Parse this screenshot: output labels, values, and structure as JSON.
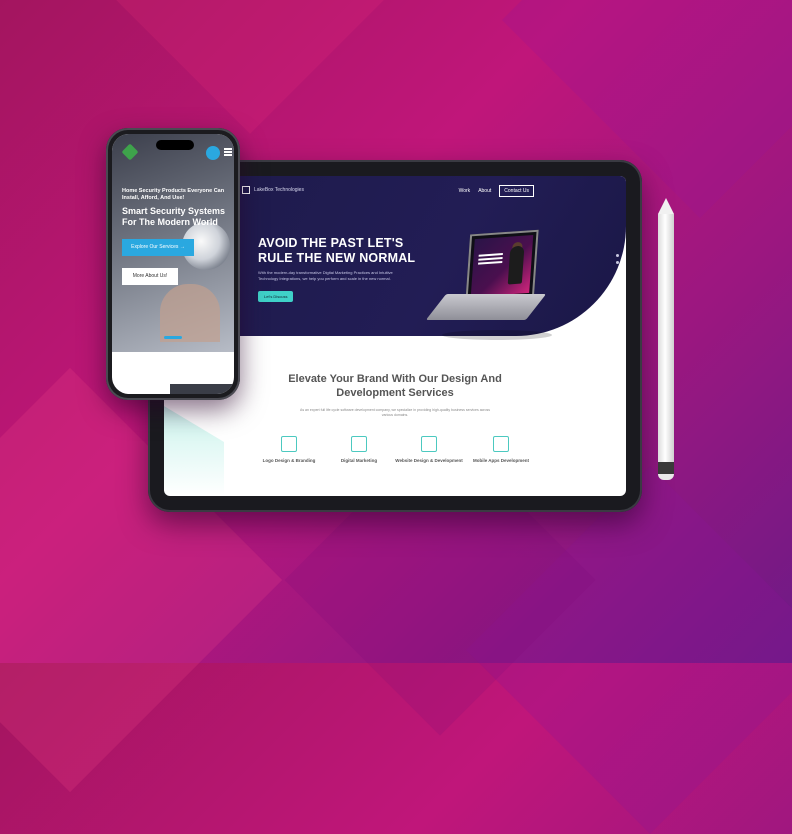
{
  "tablet_site": {
    "brand": "LakeBox Technologies",
    "nav": {
      "work": "Work",
      "about": "About",
      "contact": "Contact Us"
    },
    "hero": {
      "title": "AVOID THE PAST LET'S RULE THE NEW NORMAL",
      "text": "With the modern-day transformative Digital Marketing Practices and Intuitive Technology Integrations, we help you perform and scale in the new normal.",
      "button": "Let's Discuss"
    },
    "services": {
      "title": "Elevate Your Brand With Our Design And Development Services",
      "text": "As an expert full life cycle software development company, we specialize in providing high-quality business services across various domains.",
      "items": [
        {
          "label": "Logo Design & Branding",
          "icon": "logo-design-icon"
        },
        {
          "label": "Digital Marketing",
          "icon": "digital-marketing-icon"
        },
        {
          "label": "Website Design & Development",
          "icon": "website-design-icon"
        },
        {
          "label": "Mobile Apps Development",
          "icon": "mobile-apps-icon"
        }
      ]
    }
  },
  "phone_site": {
    "subtitle": "Home Security Products Everyone Can Install, Afford, And Use!",
    "title": "Smart Security Systems For The Modern World",
    "primary_button": "Explore Our Services",
    "primary_button_arrow": "→",
    "secondary_button": "More About Us!"
  },
  "colors": {
    "background": "#c0167a",
    "tablet_hero": "#1d1a4a",
    "accent_teal": "#3fd1c8",
    "phone_blue": "#2aa8e0"
  }
}
